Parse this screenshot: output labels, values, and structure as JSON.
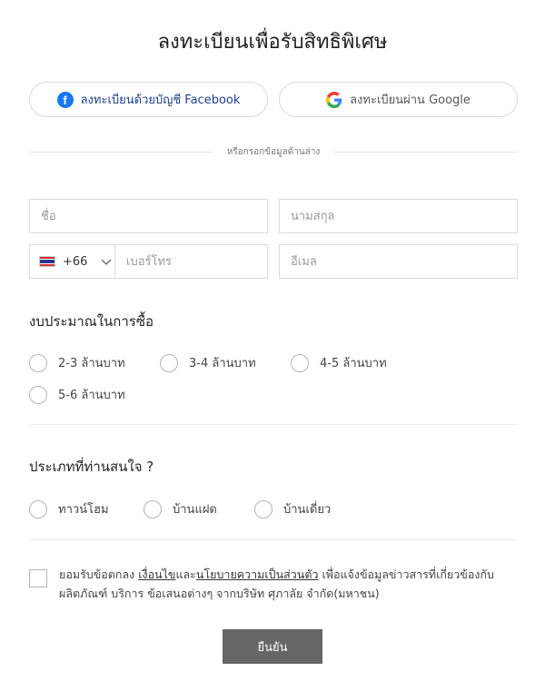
{
  "title": "ลงทะเบียนเพื่อรับสิทธิพิเศษ",
  "social": {
    "facebook_label": "ลงทะเบียนด้วยบัญชี Facebook",
    "google_label": "ลงทะเบียนผ่าน Google"
  },
  "divider_text": "หรือกรอกข้อมูลด้านล่าง",
  "form": {
    "first_name_placeholder": "ชื่อ",
    "last_name_placeholder": "นามสกุล",
    "country_code": "+66",
    "phone_placeholder": "เบอร์โทร",
    "email_placeholder": "อีเมล"
  },
  "budget": {
    "title": "งบประมาณในการซื้อ",
    "options": [
      "2-3 ล้านบาท",
      "3-4 ล้านบาท",
      "4-5 ล้านบาท",
      "5-6 ล้านบาท"
    ]
  },
  "property_type": {
    "title": "ประเภทที่ท่านสนใจ ?",
    "options": [
      "ทาวน์โฮม",
      "บ้านแฝด",
      "บ้านเดี่ยว"
    ]
  },
  "consent": {
    "prefix": "ยอมรับข้อตกลง ",
    "link_terms": "เงื่อนไข",
    "and": "และ",
    "link_privacy": "นโยบายความเป็นส่วนตัว",
    "suffix": " เพื่อแจ้งข้อมูลข่าวสารที่เกี่ยวข้องกับผลิตภัณฑ์ บริการ ข้อเสนอต่างๆ จากบริษัท ศุภาลัย จำกัด(มหาชน)"
  },
  "submit_label": "ยืนยัน",
  "colors": {
    "facebook": "#1877f2",
    "submit_bg": "#666666",
    "border": "#dcdcdc"
  },
  "icons": {
    "facebook": "facebook-icon",
    "google": "google-icon",
    "flag": "thailand-flag-icon",
    "chevron": "chevron-down-icon"
  }
}
